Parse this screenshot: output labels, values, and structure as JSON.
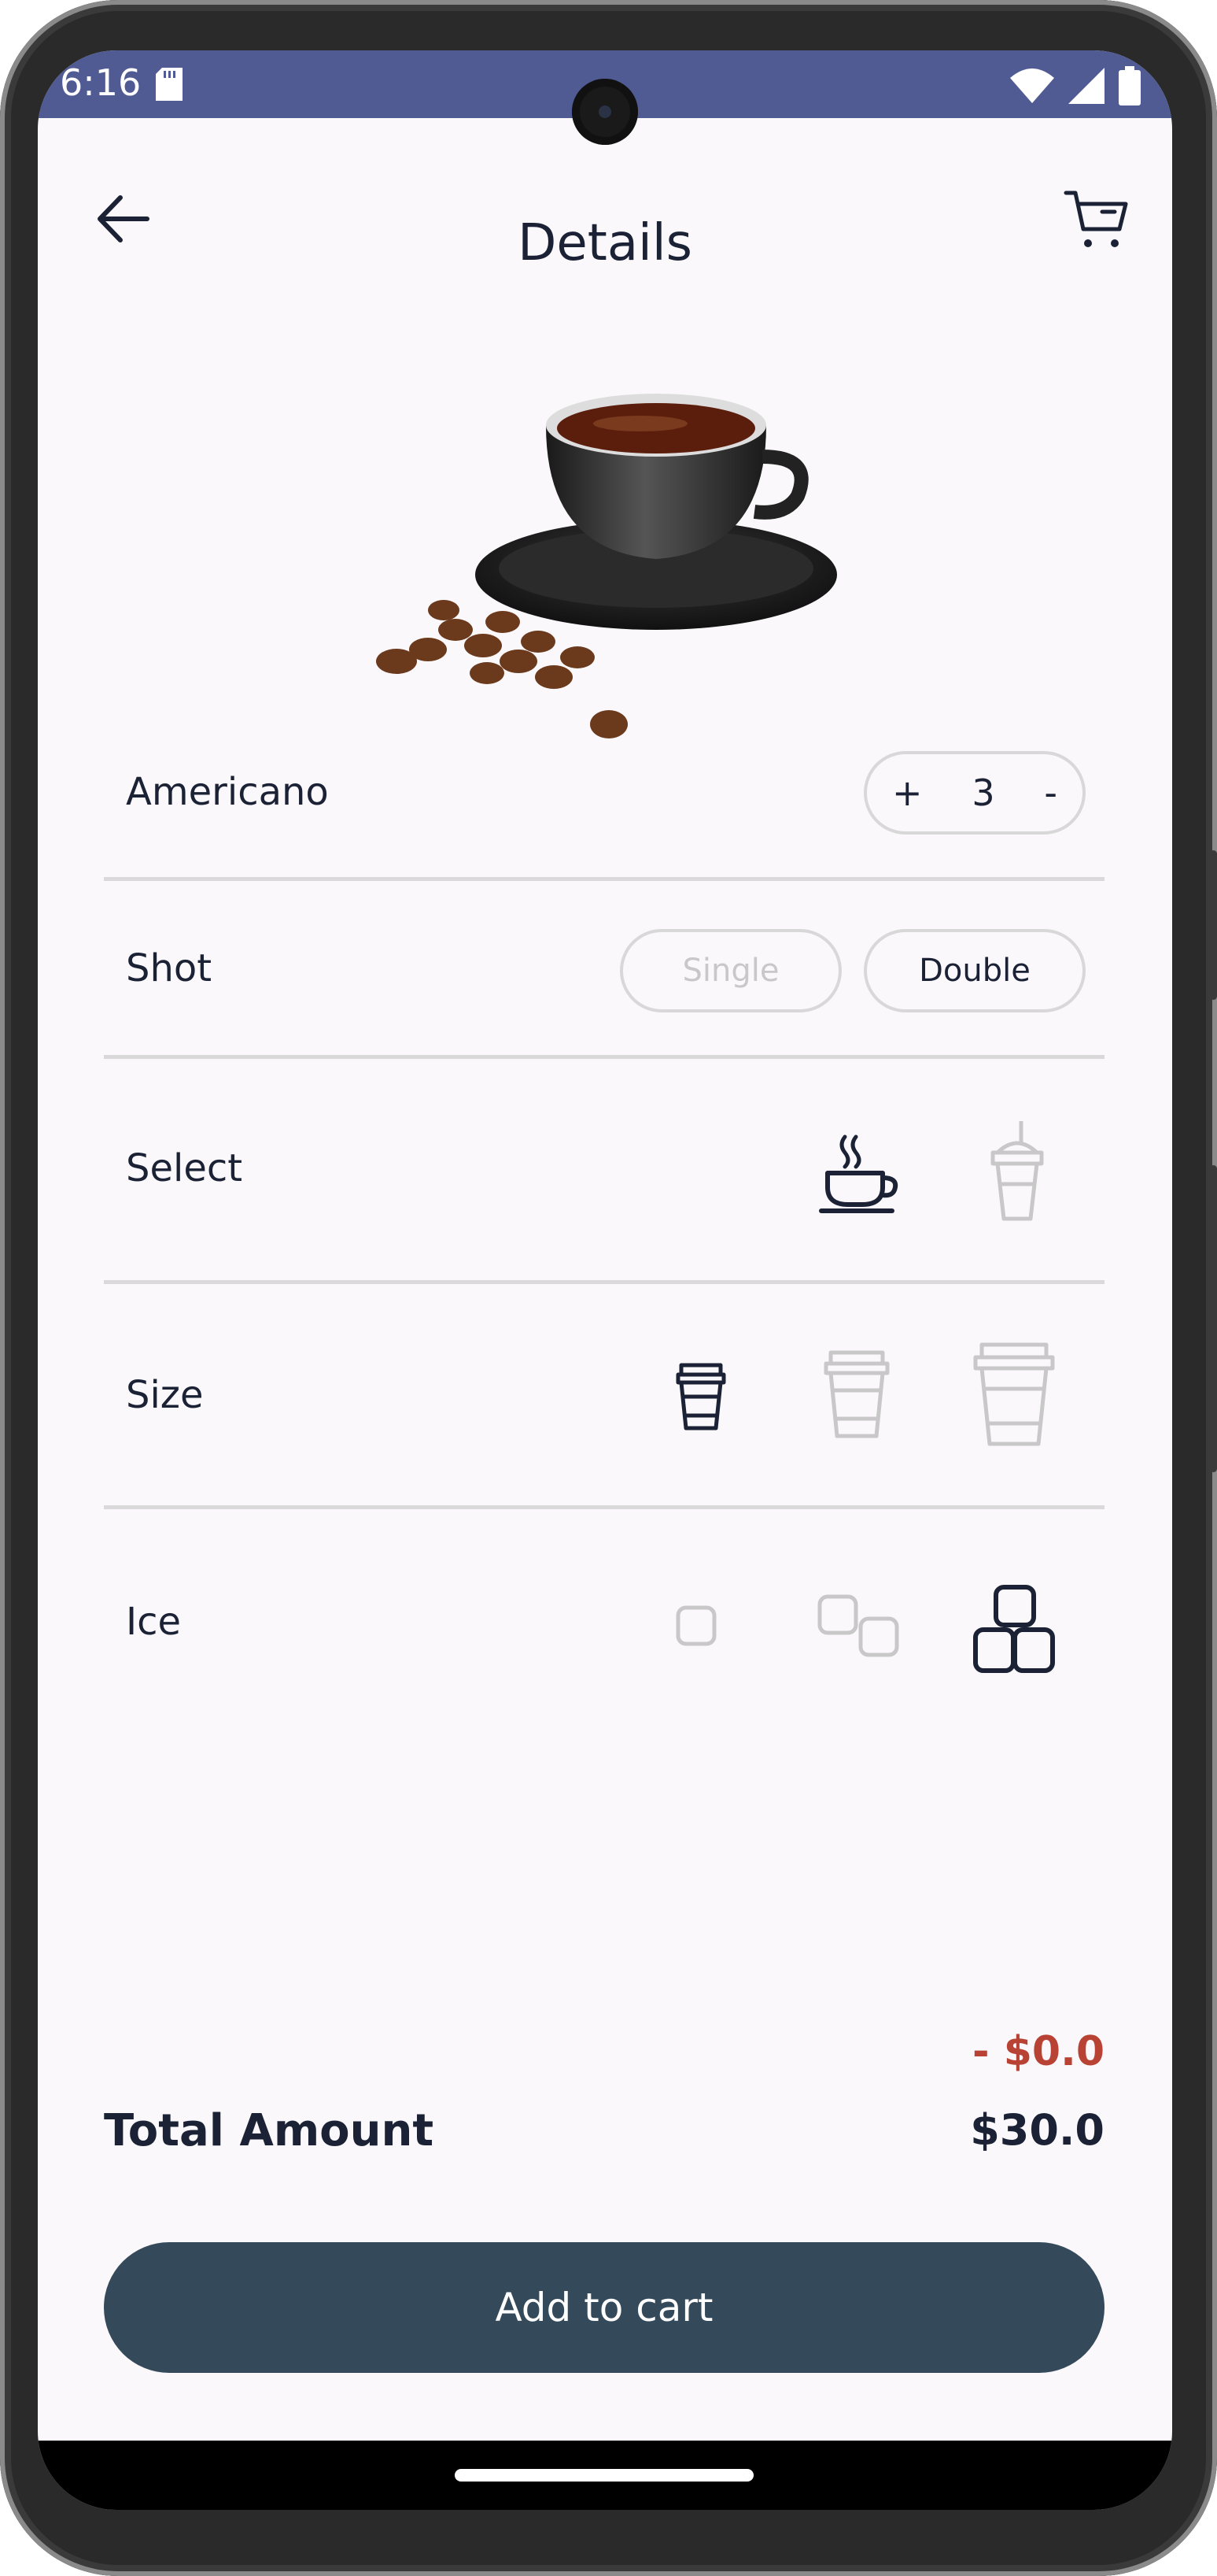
{
  "status_bar": {
    "time": "6:16"
  },
  "header": {
    "title": "Details"
  },
  "product": {
    "name": "Americano",
    "quantity": "3",
    "increment_label": "+",
    "decrement_label": "-"
  },
  "shot": {
    "label": "Shot",
    "options": [
      "Single",
      "Double"
    ],
    "selected": "Double"
  },
  "select": {
    "label": "Select",
    "options": [
      "hot-cup-icon",
      "iced-cup-icon"
    ],
    "selected": "hot-cup-icon"
  },
  "size": {
    "label": "Size",
    "options": [
      "small-cup-icon",
      "medium-cup-icon",
      "large-cup-icon"
    ],
    "selected": "small-cup-icon"
  },
  "ice": {
    "label": "Ice",
    "options": [
      "one-ice-icon",
      "two-ice-icon",
      "three-ice-icon"
    ],
    "selected": "three-ice-icon"
  },
  "totals": {
    "discount": "- $0.0",
    "total_label": "Total Amount",
    "total_value": "$30.0"
  },
  "actions": {
    "add_to_cart": "Add to cart"
  },
  "colors": {
    "status_bar": "#4f5b92",
    "primary_button": "#34495a",
    "discount": "#b84234",
    "text": "#1b2235",
    "inactive": "#c8c8c8"
  }
}
